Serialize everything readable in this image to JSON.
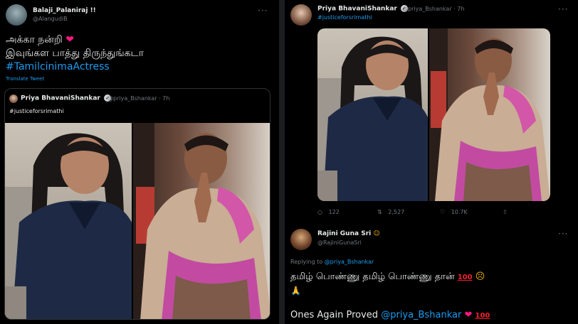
{
  "left": {
    "author_name": "Balaji_Palaniraj !!",
    "author_handle": "@AlangudiB",
    "line1": "அக்கா நன்றி",
    "line2": "இவுங்கள பாத்து திருந்துங்கடா",
    "hashtag": "#TamilcinimaActress",
    "translate": "Translate Tweet",
    "quote": {
      "author_name": "Priya BhavaniShankar",
      "author_handle": "@priya_Bshankar",
      "time": "· 7h",
      "text": "#justiceforsrimathi"
    }
  },
  "right": {
    "author_name": "Priya BhavaniShankar",
    "author_handle": "@priya_Bshankar · 7h",
    "hashtag": "#justiceforsrimathi",
    "actions": {
      "replies": "122",
      "retweets": "2,527",
      "likes": "10.7K"
    },
    "reply": {
      "author_name": "Rajini Guna Sri",
      "author_handle": "@RajiniGunaSri",
      "replying_prefix": "Replying to",
      "replying_handle": "@priya_Bshankar",
      "line1": "தமிழ் பொண்ணு தமிழ் பொண்ணு தான்",
      "line2_prefix": "Ones Again Proved",
      "line2_handle": "@priya_Bshankar"
    }
  },
  "colors": {
    "background": "#000000",
    "text": "#e7e9ea",
    "muted": "#71767b",
    "link": "#1d9bf0",
    "heart": "#f91880"
  }
}
